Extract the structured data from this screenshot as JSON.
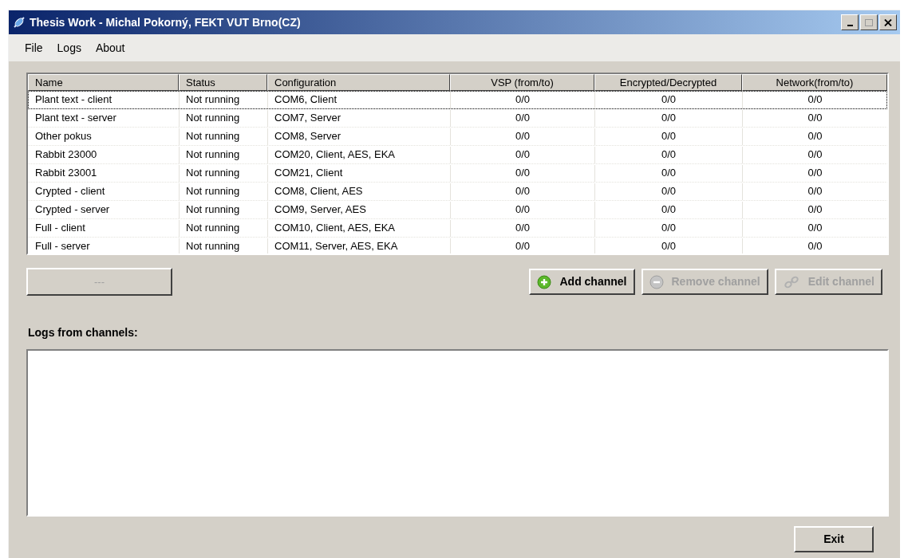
{
  "window": {
    "title": "Thesis Work - Michal Pokorný, FEKT VUT Brno(CZ)"
  },
  "menu": [
    "File",
    "Logs",
    "About"
  ],
  "table": {
    "columns": [
      "Name",
      "Status",
      "Configuration",
      "VSP (from/to)",
      "Encrypted/Decrypted",
      "Network(from/to)"
    ],
    "rows": [
      {
        "cells": [
          "Plant text - client",
          "Not running",
          "COM6, Client",
          "0/0",
          "0/0",
          "0/0"
        ],
        "focused": true
      },
      {
        "cells": [
          "Plant text - server",
          "Not running",
          "COM7, Server",
          "0/0",
          "0/0",
          "0/0"
        ],
        "focused": false
      },
      {
        "cells": [
          "Other pokus",
          "Not running",
          "COM8, Server",
          "0/0",
          "0/0",
          "0/0"
        ],
        "focused": false
      },
      {
        "cells": [
          "Rabbit 23000",
          "Not running",
          "COM20, Client, AES, EKA",
          "0/0",
          "0/0",
          "0/0"
        ],
        "focused": false
      },
      {
        "cells": [
          "Rabbit 23001",
          "Not running",
          "COM21, Client",
          "0/0",
          "0/0",
          "0/0"
        ],
        "focused": false
      },
      {
        "cells": [
          "Crypted - client",
          "Not running",
          "COM8, Client, AES",
          "0/0",
          "0/0",
          "0/0"
        ],
        "focused": false
      },
      {
        "cells": [
          "Crypted - server",
          "Not running",
          "COM9, Server, AES",
          "0/0",
          "0/0",
          "0/0"
        ],
        "focused": false
      },
      {
        "cells": [
          "Full - client",
          "Not running",
          "COM10, Client, AES, EKA",
          "0/0",
          "0/0",
          "0/0"
        ],
        "focused": false
      },
      {
        "cells": [
          "Full - server",
          "Not running",
          "COM11, Server, AES, EKA",
          "0/0",
          "0/0",
          "0/0"
        ],
        "focused": false
      }
    ]
  },
  "toggle_button": {
    "label": "---",
    "disabled": true
  },
  "channel_buttons": [
    {
      "kind": "add",
      "label": "Add channel",
      "disabled": false
    },
    {
      "kind": "remove",
      "label": "Remove channel",
      "disabled": true
    },
    {
      "kind": "edit",
      "label": "Edit channel",
      "disabled": true
    }
  ],
  "logs_label": "Logs from channels:",
  "exit_button": {
    "label": "Exit"
  }
}
